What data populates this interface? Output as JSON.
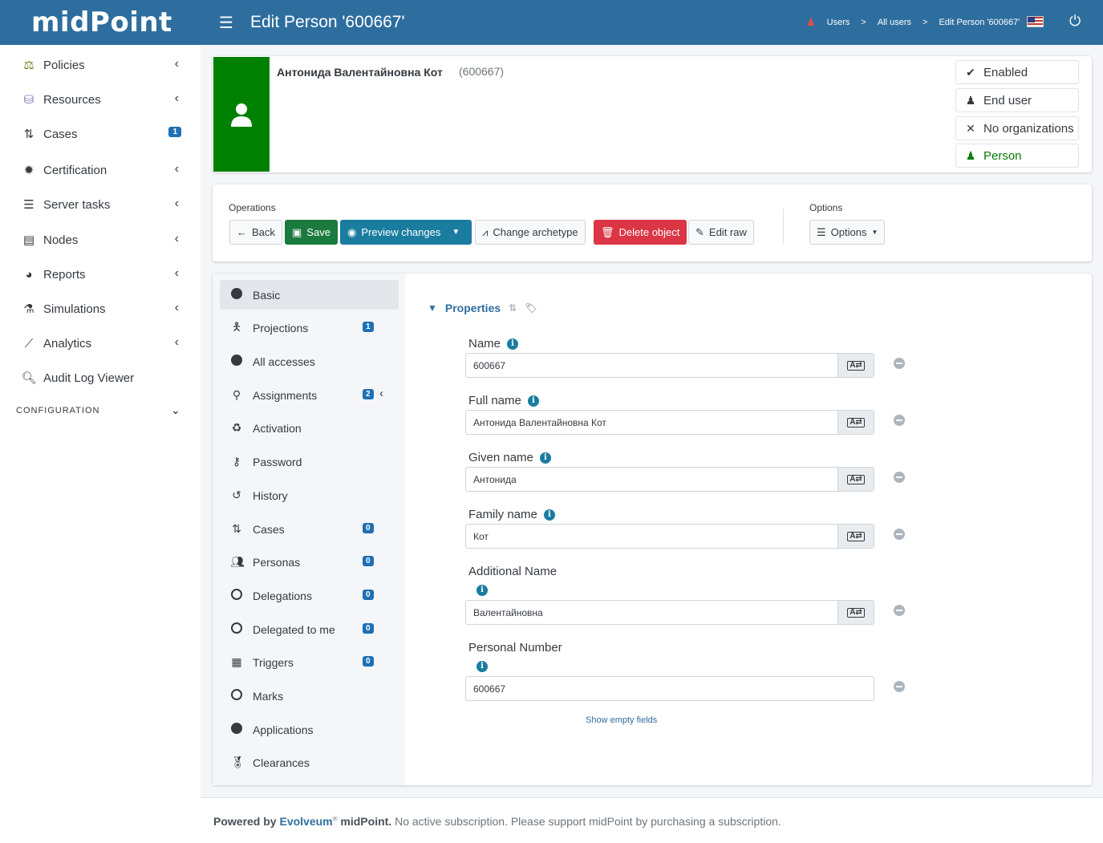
{
  "header": {
    "logo": "midPoint",
    "title": "Edit Person '600667'",
    "breadcrumbs": [
      "Users",
      "All users",
      "Edit Person '600667'"
    ],
    "breadcrumb_separator": ">"
  },
  "sidebar": {
    "items": [
      {
        "label": "Policies",
        "icon": "scale-icon"
      },
      {
        "label": "Resources",
        "icon": "database-icon"
      },
      {
        "label": "Cases",
        "icon": "cases-icon",
        "badge": "1"
      },
      {
        "label": "Certification",
        "icon": "certificate-icon"
      },
      {
        "label": "Server tasks",
        "icon": "tasks-icon"
      },
      {
        "label": "Nodes",
        "icon": "server-icon"
      },
      {
        "label": "Reports",
        "icon": "pie-chart-icon"
      },
      {
        "label": "Simulations",
        "icon": "flask-icon"
      },
      {
        "label": "Analytics",
        "icon": "line-chart-icon"
      },
      {
        "label": "Audit Log Viewer",
        "icon": "audit-icon"
      }
    ],
    "section": "CONFIGURATION"
  },
  "summary": {
    "name": "Антонида Валентайновна Кот",
    "oid": "(600667)",
    "tags": [
      {
        "label": "Enabled",
        "icon": "check-icon"
      },
      {
        "label": "End user",
        "icon": "user-icon"
      },
      {
        "label": "No organizations",
        "icon": "x-icon"
      },
      {
        "label": "Person",
        "icon": "user-icon"
      }
    ],
    "avatar_color": "#008000"
  },
  "operations": {
    "label": "Operations",
    "back": "Back",
    "save": "Save",
    "preview": "Preview changes",
    "change_archetype": "Change archetype",
    "delete": "Delete object",
    "edit_raw": "Edit raw",
    "options_label": "Options",
    "options_button": "Options"
  },
  "tabs": [
    {
      "label": "Basic",
      "icon": "dot-icon",
      "active": true
    },
    {
      "label": "Projections",
      "icon": "person-icon",
      "badge": "1"
    },
    {
      "label": "All accesses",
      "icon": "dot-icon"
    },
    {
      "label": "Assignments",
      "icon": "assignment-icon",
      "badge": "2"
    },
    {
      "label": "Activation",
      "icon": "recycle-icon"
    },
    {
      "label": "Password",
      "icon": "key-icon"
    },
    {
      "label": "History",
      "icon": "history-icon"
    },
    {
      "label": "Cases",
      "icon": "cases-icon",
      "badge": "0"
    },
    {
      "label": "Personas",
      "icon": "users-icon",
      "badge": "0"
    },
    {
      "label": "Delegations",
      "icon": "ring-icon",
      "badge": "0"
    },
    {
      "label": "Delegated to me",
      "icon": "ring-icon",
      "badge": "0"
    },
    {
      "label": "Triggers",
      "icon": "calendar-icon",
      "badge": "0"
    },
    {
      "label": "Marks",
      "icon": "ring-icon"
    },
    {
      "label": "Applications",
      "icon": "dot-icon"
    },
    {
      "label": "Clearances",
      "icon": "award-icon"
    }
  ],
  "properties": {
    "title": "Properties",
    "fields": [
      {
        "label": "Name",
        "value": "600667"
      },
      {
        "label": "Full name",
        "value": "Антонида Валентайновна Кот"
      },
      {
        "label": "Given name",
        "value": "Антонида"
      },
      {
        "label": "Family name",
        "value": "Кот"
      },
      {
        "label": "Additional Name",
        "value": "Валентайновна"
      },
      {
        "label": "Personal Number",
        "value": "600667"
      }
    ],
    "show_empty": "Show empty fields"
  },
  "footer": {
    "powered": "Powered by",
    "company": "Evolveum",
    "product": "midPoint.",
    "notice": "No active subscription. Please support midPoint by purchasing a subscription."
  },
  "colors": {
    "header": "#2e6e9e",
    "save": "#1b7a3e",
    "preview": "#1a7da0",
    "delete": "#dc3545",
    "badge": "#1f6fb4"
  }
}
